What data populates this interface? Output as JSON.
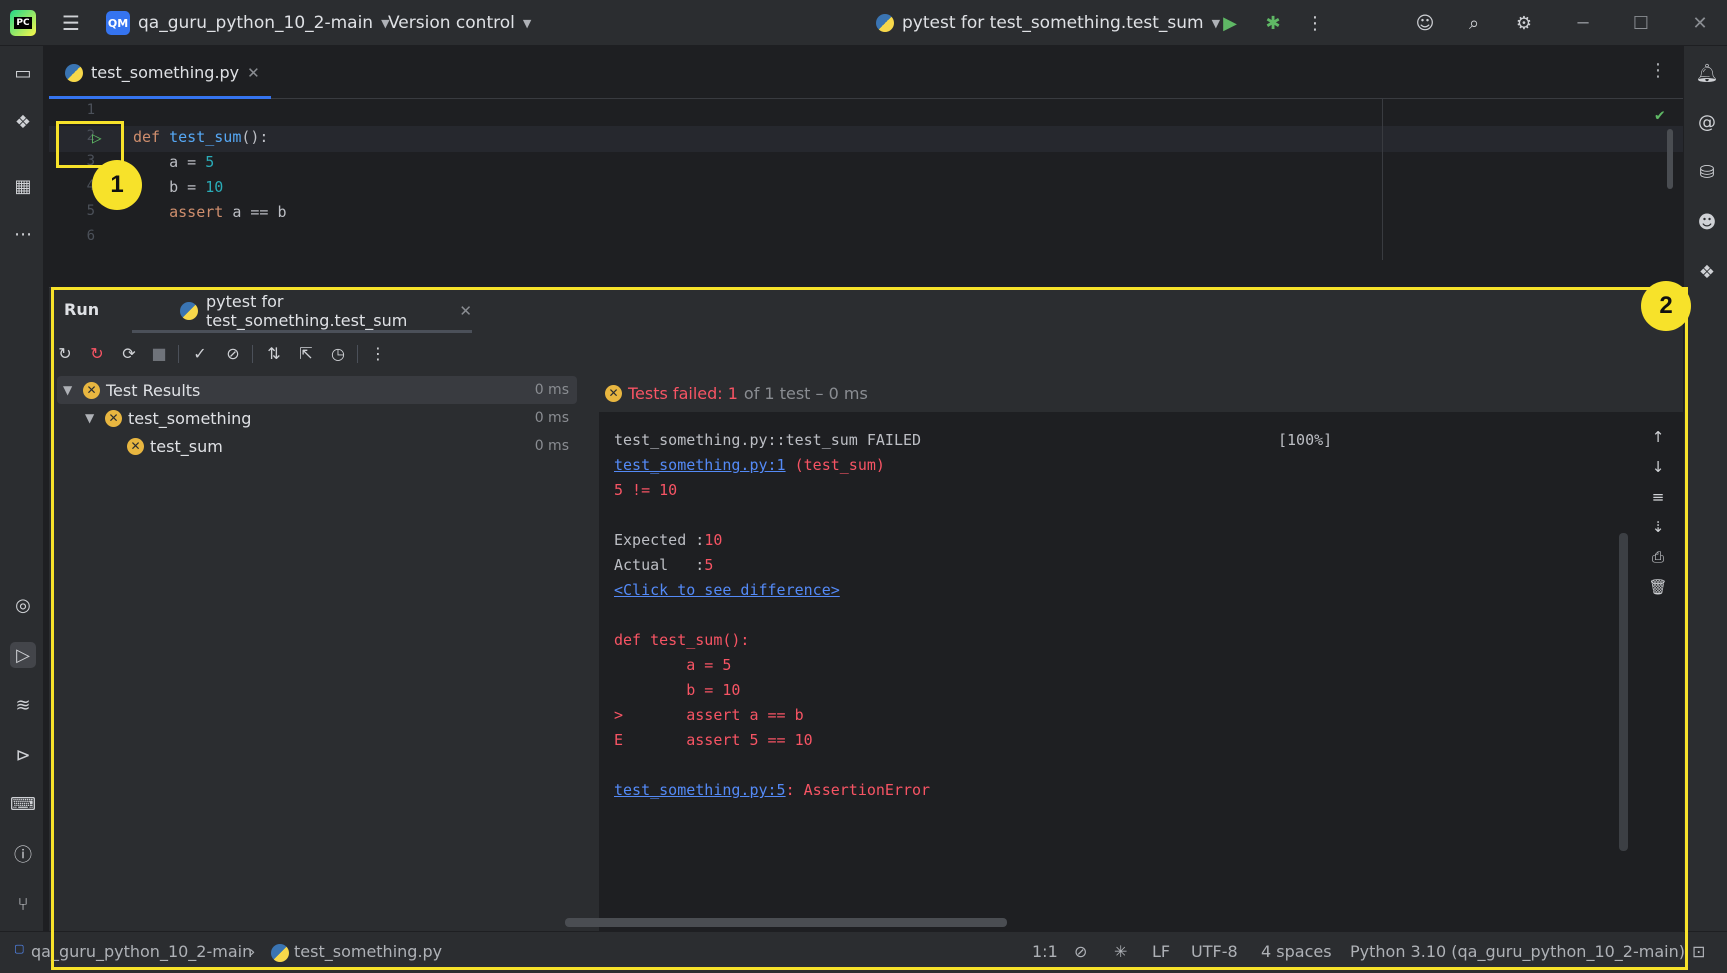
{
  "window": {
    "project": "qa_guru_python_10_2-main",
    "project_badge": "QM",
    "vcs": "Version control",
    "run_config": "pytest for test_something.test_sum",
    "logo_text": "PC"
  },
  "editor": {
    "tab_label": "test_something.py",
    "line_numbers": [
      "1",
      "2",
      "3",
      "4",
      "5",
      "6"
    ],
    "code": {
      "l2_def": "def ",
      "l2_fn": "test_sum",
      "l2_rest": "():",
      "l3_a": "    a = ",
      "l3_num": "5",
      "l4_b": "    b = ",
      "l4_num": "10",
      "l5_kw": "    assert",
      "l5_rest": " a == b"
    }
  },
  "annotations": {
    "badge1": "1",
    "badge2": "2"
  },
  "run": {
    "title": "Run",
    "tab_label": "pytest for test_something.test_sum",
    "tree": [
      {
        "label": "Test Results",
        "time": "0 ms"
      },
      {
        "label": "test_something",
        "time": "0 ms"
      },
      {
        "label": "test_sum",
        "time": "0 ms"
      }
    ],
    "summary_failed": "Tests failed: 1",
    "summary_rest": "of 1 test – 0 ms",
    "console": {
      "l1": "test_something.py::test_sum FAILED",
      "l1_pct": "[100%]",
      "l2_link": "test_something.py:1",
      "l2_rest": " (test_sum)",
      "l3": "5 != 10",
      "l5_label": "Expected :",
      "l5_val": "10",
      "l6_label": "Actual   :",
      "l6_val": "5",
      "l7_link": "<Click to see difference>",
      "l9": "def test_sum():",
      "l10": "        a = 5",
      "l11": "        b = 10",
      "l12": ">       assert a == b",
      "l13": "E       assert 5 == 10",
      "l15_link": "test_something.py:5",
      "l15_rest": ": AssertionError"
    }
  },
  "status": {
    "project": "qa_guru_python_10_2-main",
    "file": "test_something.py",
    "position": "1:1",
    "line_sep": "LF",
    "encoding": "UTF-8",
    "indent": "4 spaces",
    "interpreter": "Python 3.10 (qa_guru_python_10_2-main)"
  },
  "colors": {
    "accent": "#3574f0",
    "error": "#f75464",
    "highlight": "#f7e22a",
    "run_green": "#5fb865"
  }
}
